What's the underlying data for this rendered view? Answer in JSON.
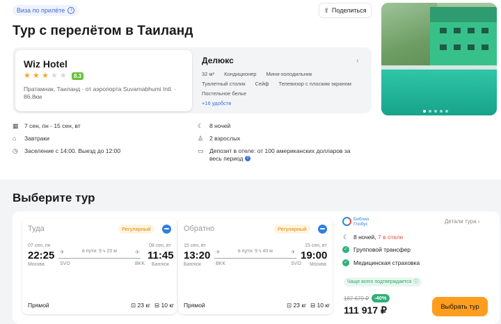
{
  "header": {
    "visa_badge": "Виза по прилёте",
    "share_label": "Поделиться",
    "title": "Тур с перелётом в Таиланд"
  },
  "hotel": {
    "name": "Wiz Hotel",
    "stars": 3,
    "stars_total": 5,
    "rating": "8.3",
    "location": "Пратамнак, Таиланд · от аэропорта Suvarnabhumi Intl. · 86.8км"
  },
  "room": {
    "title": "Делюкс",
    "amenities": [
      "32 м²",
      "Кондиционер",
      "Мини-холодильник",
      "Туалетный столик",
      "Сейф",
      "Телевизор с плоским экраном",
      "Постельное белье"
    ],
    "more": "+16 удобств"
  },
  "photo": {
    "slides": 5,
    "active_slide": 1
  },
  "details": {
    "dates": "7 сен, пн - 15 сен, вт",
    "meals": "Завтраки",
    "check": "Заселение с 14:00. Выезд до 12:00",
    "nights": "8 ночей",
    "guests": "2 взрослых",
    "deposit": "Депозит в отеле: от 100 американских долларов за весь период"
  },
  "choose": {
    "title": "Выберите тур"
  },
  "legs": [
    {
      "title": "Туда",
      "badge": "Регулярный",
      "dep_date": "07 сен, пн",
      "dep_time": "22:25",
      "dep_city": "Москва",
      "dep_code": "SVO",
      "duration": "в пути: 9 ч 20 м",
      "arr_date": "08 сен, вт",
      "arr_time": "11:45",
      "arr_city": "Бангкок",
      "arr_code": "BKK",
      "type": "Прямой",
      "bag": "23 кг",
      "hand": "10 кг"
    },
    {
      "title": "Обратно",
      "badge": "Регулярный",
      "dep_date": "15 сен, вт",
      "dep_time": "13:20",
      "dep_city": "Бангкок",
      "dep_code": "BKK",
      "duration": "в пути: 9 ч 40 м",
      "arr_date": "15 сен, вт",
      "arr_time": "19:00",
      "arr_city": "Москва",
      "arr_code": "SVO",
      "type": "Прямой",
      "bag": "23 кг",
      "hand": "10 кг"
    }
  ],
  "summary": {
    "operator": "Библио Глобус",
    "tour_details": "Детали тура",
    "nights_prefix": "8 ночей, ",
    "nights_hotel": "7 в отеле",
    "transfer": "Групповой трансфер",
    "insurance": "Медицинская страховка",
    "confirm": "Чаще всего подтверждается",
    "old_price": "187 679 ₽",
    "discount": "-40%",
    "price": "111 917 ₽",
    "buy_label": "Выбрать тур"
  },
  "colors": {
    "accent": "#ff9d1f",
    "link": "#3b6fd8",
    "success": "#2fb078",
    "rating": "#6bbf3b"
  }
}
